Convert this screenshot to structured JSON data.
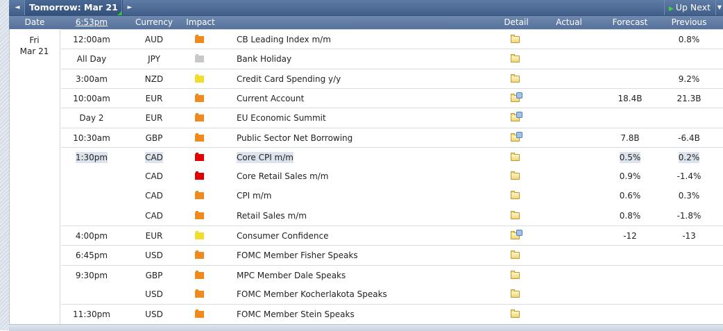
{
  "nav": {
    "day_title": "Tomorrow: Mar 21",
    "up_next_label": "Up Next",
    "prev_glyph": "◄",
    "next_glyph": "►",
    "caret_glyph": "▼"
  },
  "columns": {
    "date": "Date",
    "time": "6:53pm",
    "currency": "Currency",
    "impact": "Impact",
    "detail": "Detail",
    "actual": "Actual",
    "forecast": "Forecast",
    "previous": "Previous"
  },
  "date_cell": {
    "weekday": "Fri",
    "date": "Mar 21"
  },
  "impact_colors": {
    "high": "#e30000",
    "medium": "#f08a1c",
    "low": "#f2dd2a",
    "holiday": "#c8c8c8"
  },
  "events": [
    {
      "time": "12:00am",
      "currency": "AUD",
      "impact": "medium",
      "event": "CB Leading Index m/m",
      "detail_icon": "folder-icon",
      "actual": "",
      "forecast": "",
      "previous": "0.8%"
    },
    {
      "time": "All Day",
      "currency": "JPY",
      "impact": "holiday",
      "event": "Bank Holiday",
      "detail_icon": "folder-icon",
      "actual": "",
      "forecast": "",
      "previous": ""
    },
    {
      "time": "3:00am",
      "currency": "NZD",
      "impact": "low",
      "event": "Credit Card Spending y/y",
      "detail_icon": "folder-icon",
      "actual": "",
      "forecast": "",
      "previous": "9.2%"
    },
    {
      "time": "10:00am",
      "currency": "EUR",
      "impact": "medium",
      "event": "Current Account",
      "detail_icon": "folder-plus-icon",
      "actual": "",
      "forecast": "18.4B",
      "previous": "21.3B"
    },
    {
      "time": "Day 2",
      "currency": "EUR",
      "impact": "medium",
      "event": "EU Economic Summit",
      "detail_icon": "folder-plus-icon",
      "actual": "",
      "forecast": "",
      "previous": ""
    },
    {
      "time": "10:30am",
      "currency": "GBP",
      "impact": "medium",
      "event": "Public Sector Net Borrowing",
      "detail_icon": "folder-plus-icon",
      "actual": "",
      "forecast": "7.8B",
      "previous": "-6.4B"
    },
    {
      "time": "1:30pm",
      "currency": "CAD",
      "impact": "high",
      "event": "Core CPI m/m",
      "detail_icon": "folder-icon",
      "actual": "",
      "forecast": "0.5%",
      "previous": "0.2%"
    },
    {
      "time": "",
      "currency": "CAD",
      "impact": "high",
      "event": "Core Retail Sales m/m",
      "detail_icon": "folder-icon",
      "actual": "",
      "forecast": "0.9%",
      "previous": "-1.4%"
    },
    {
      "time": "",
      "currency": "CAD",
      "impact": "medium",
      "event": "CPI m/m",
      "detail_icon": "folder-icon",
      "actual": "",
      "forecast": "0.6%",
      "previous": "0.3%"
    },
    {
      "time": "",
      "currency": "CAD",
      "impact": "medium",
      "event": "Retail Sales m/m",
      "detail_icon": "folder-icon",
      "actual": "",
      "forecast": "0.8%",
      "previous": "-1.8%"
    },
    {
      "time": "4:00pm",
      "currency": "EUR",
      "impact": "low",
      "event": "Consumer Confidence",
      "detail_icon": "folder-plus-icon",
      "actual": "",
      "forecast": "-12",
      "previous": "-13"
    },
    {
      "time": "6:45pm",
      "currency": "USD",
      "impact": "medium",
      "event": "FOMC Member Fisher Speaks",
      "detail_icon": "folder-icon",
      "actual": "",
      "forecast": "",
      "previous": ""
    },
    {
      "time": "9:30pm",
      "currency": "GBP",
      "impact": "medium",
      "event": "MPC Member Dale Speaks",
      "detail_icon": "folder-icon",
      "actual": "",
      "forecast": "",
      "previous": ""
    },
    {
      "time": "",
      "currency": "USD",
      "impact": "medium",
      "event": "FOMC Member Kocherlakota Speaks",
      "detail_icon": "folder-icon",
      "actual": "",
      "forecast": "",
      "previous": ""
    },
    {
      "time": "11:30pm",
      "currency": "USD",
      "impact": "medium",
      "event": "FOMC Member Stein Speaks",
      "detail_icon": "folder-icon",
      "actual": "",
      "forecast": "",
      "previous": ""
    }
  ]
}
